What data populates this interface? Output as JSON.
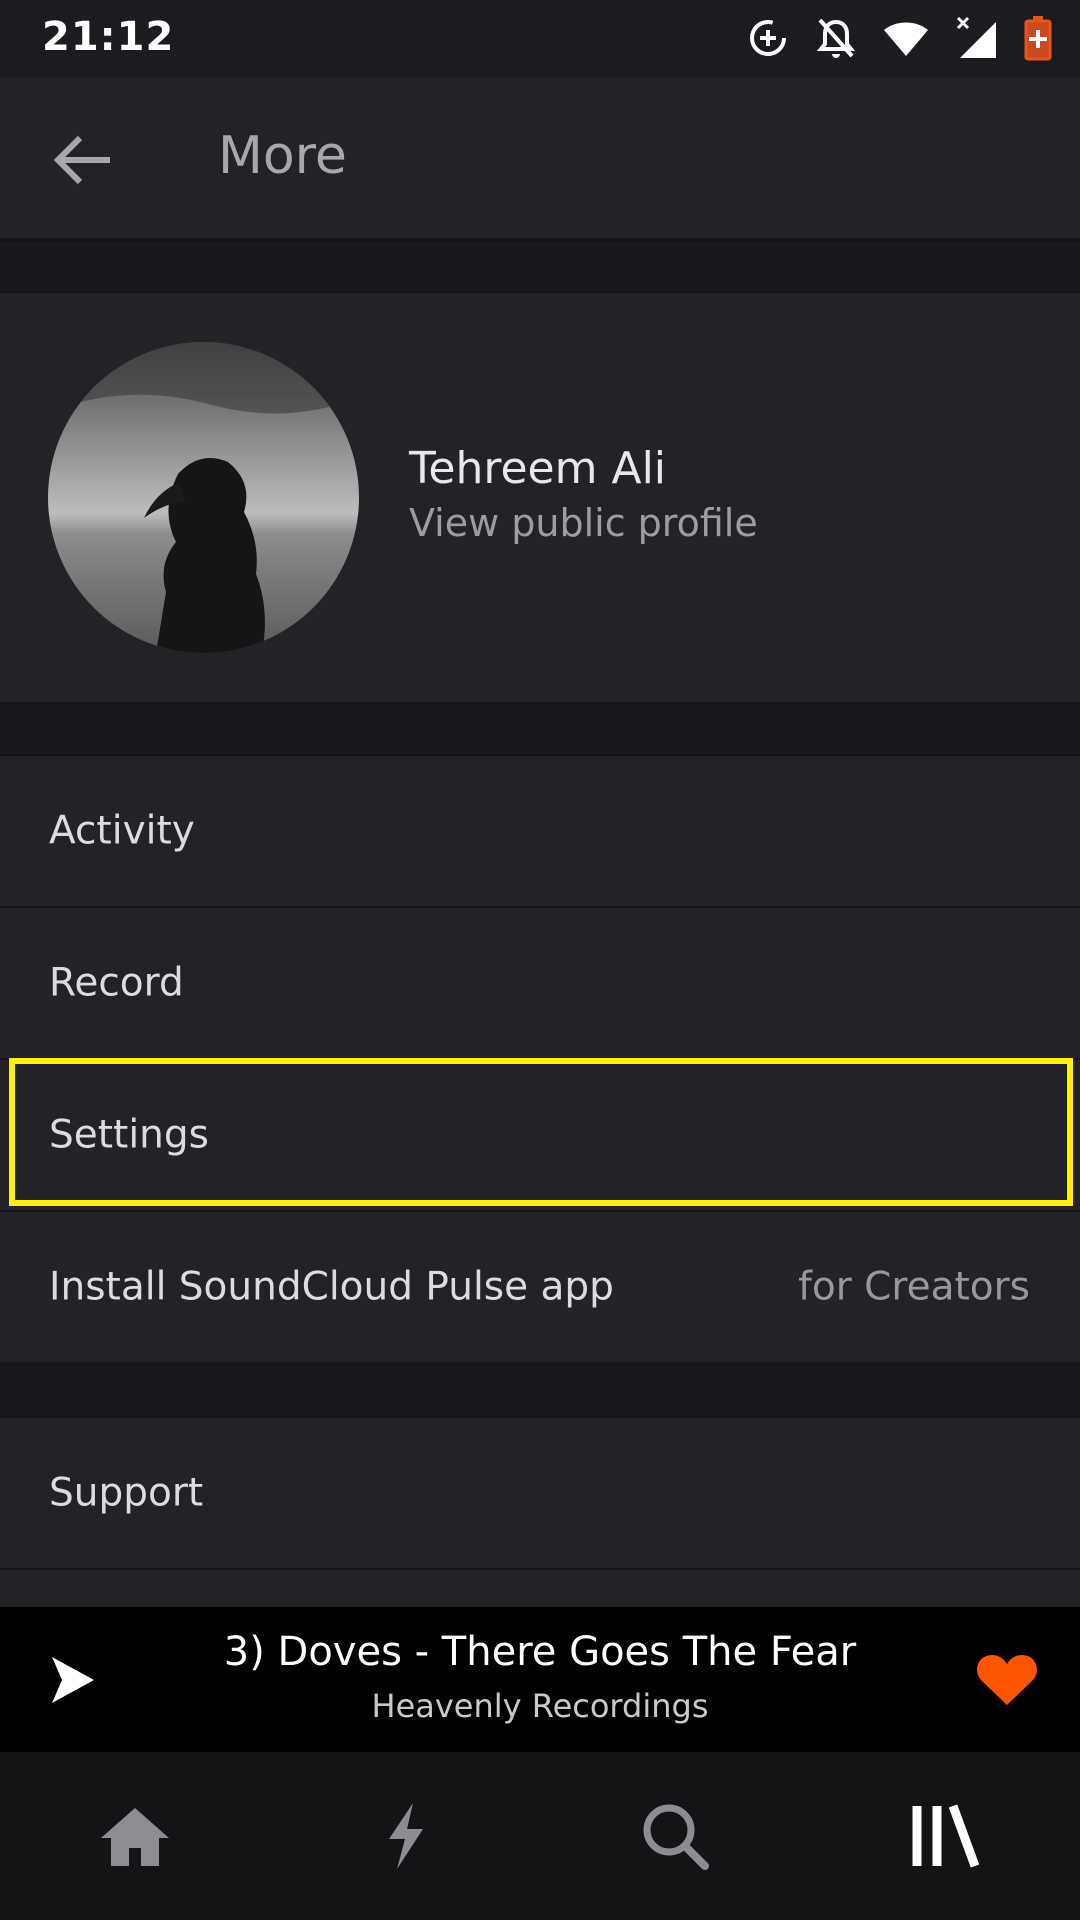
{
  "status_bar": {
    "time": "21:12",
    "icons": [
      "data-saver-icon",
      "notifications-off-icon",
      "wifi-icon",
      "signal-icon",
      "battery-icon"
    ],
    "battery_color": "#e8541d"
  },
  "app_bar": {
    "back_icon": "arrow-back-icon",
    "title": "More"
  },
  "profile": {
    "name": "Tehreem Ali",
    "link": "View public profile"
  },
  "menu": {
    "items": [
      {
        "label": "Activity"
      },
      {
        "label": "Record"
      },
      {
        "label": "Settings"
      },
      {
        "label": "Install SoundCloud Pulse app",
        "aside": "for Creators"
      },
      {
        "label": "Support"
      }
    ]
  },
  "player": {
    "title": "3) Doves - There Goes The Fear",
    "artist": "Heavenly Recordings",
    "play_icon": "play-icon",
    "like_icon": "heart-icon",
    "accent": "#ff5500"
  },
  "nav": {
    "items": [
      {
        "icon": "home-icon",
        "selected": false
      },
      {
        "icon": "stream-icon",
        "selected": false
      },
      {
        "icon": "search-icon",
        "selected": false
      },
      {
        "icon": "library-icon",
        "selected": true
      }
    ]
  },
  "highlight_color": "#fff200"
}
